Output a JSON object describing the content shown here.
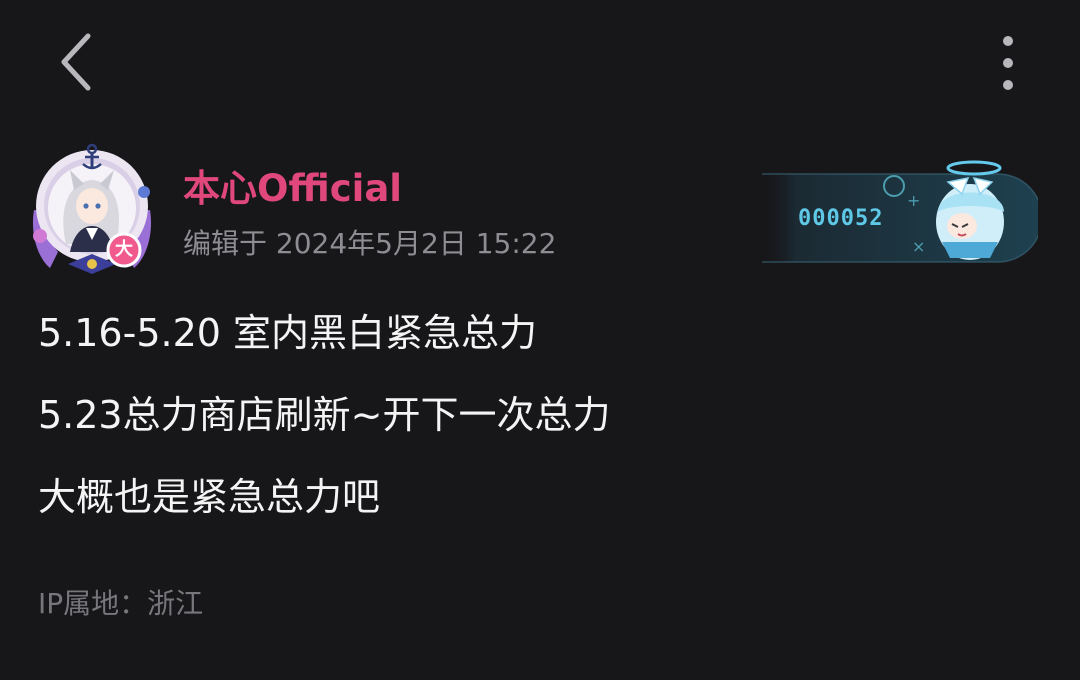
{
  "header": {
    "back_icon": "chevron-left-icon",
    "more_icon": "vertical-dots-icon"
  },
  "author": {
    "name": "本心Official",
    "edit_time": "编辑于 2024年5月2日 15:22",
    "name_color": "#e0487c",
    "avatar_badge": "大"
  },
  "fan_badge": {
    "number": "000052"
  },
  "post": {
    "lines": [
      "5.16-5.20 室内黑白紧急总力",
      "5.23总力商店刷新~开下一次总力",
      "大概也是紧急总力吧"
    ]
  },
  "footer": {
    "ip_location": "IP属地：浙江"
  }
}
